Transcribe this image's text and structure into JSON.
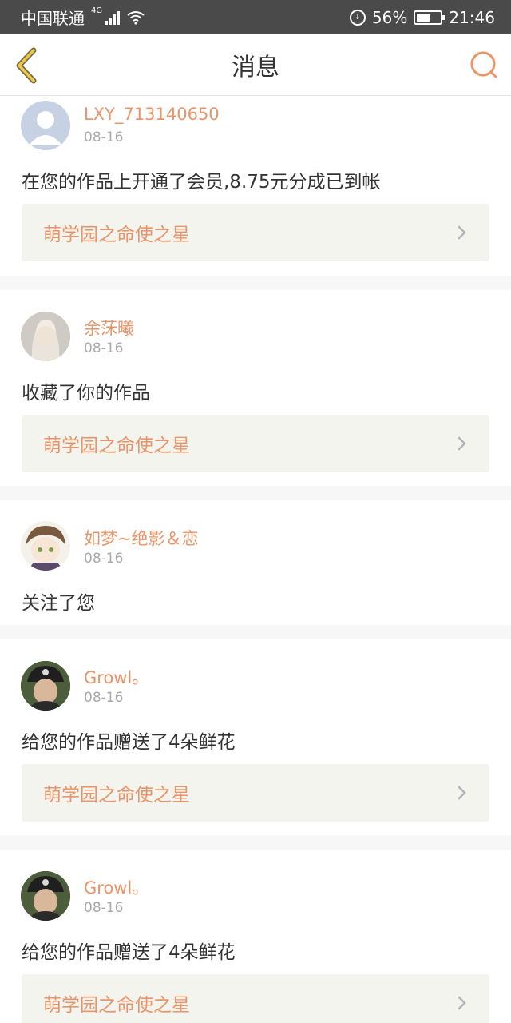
{
  "status_bar": {
    "carrier": "中国联通",
    "network": "4G",
    "battery_percent": "56%",
    "battery_level": 0.56,
    "time": "21:46",
    "icons": [
      "signal-icon",
      "wifi-icon",
      "data-saver-icon",
      "battery-icon"
    ]
  },
  "header": {
    "title": "消息",
    "back_icon": "chevron-left-icon",
    "search_icon": "search-icon"
  },
  "accent_color": "#e9956a",
  "messages": [
    {
      "user": "LXY_713140650",
      "date": "08-16",
      "text": "在您的作品上开通了会员,8.75元分成已到帐",
      "work": "萌学园之命使之星",
      "avatar": "default-avatar"
    },
    {
      "user": "余莯曦",
      "date": "08-16",
      "text": "收藏了你的作品",
      "work": "萌学园之命使之星",
      "avatar": "photo-avatar"
    },
    {
      "user": "如梦~绝影＆恋",
      "date": "08-16",
      "text": "关注了您",
      "work": null,
      "avatar": "anime-avatar"
    },
    {
      "user": "Growl。",
      "date": "08-16",
      "text": "给您的作品赠送了4朵鲜花",
      "work": "萌学园之命使之星",
      "avatar": "photo-avatar"
    },
    {
      "user": "Growl。",
      "date": "08-16",
      "text": "给您的作品赠送了4朵鲜花",
      "work": "萌学园之命使之星",
      "avatar": "photo-avatar"
    }
  ]
}
